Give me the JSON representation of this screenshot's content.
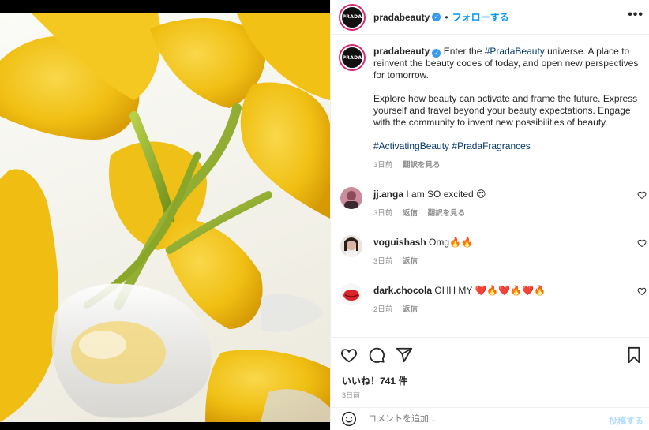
{
  "header": {
    "avatar_text": "PRADA",
    "username": "pradabeauty",
    "verified_mark": "✓",
    "dot": "•",
    "follow_label": "フォローする",
    "more_label": "•••"
  },
  "caption": {
    "avatar_text": "PRADA",
    "username": "pradabeauty",
    "text_1": "Enter the ",
    "tag_1": "#PradaBeauty",
    "text_2": " universe. A place to reinvent the beauty codes of today, and open new perspectives for tomorrow.",
    "paragraph_2": "Explore how beauty can activate and frame the future. Express yourself and travel beyond your beauty expectations. Engage with the community to invent new possibilities of beauty.",
    "tag_2": "#ActivatingBeauty",
    "tag_3": "#PradaFragrances",
    "time": "3日前",
    "translate": "翻訳を見る"
  },
  "comments": [
    {
      "username": "jj.anga",
      "text": "I am SO excited 😍",
      "time": "3日前",
      "reply": "返信",
      "translate": "翻訳を見る"
    },
    {
      "username": "voguishash",
      "text": "Omg🔥🔥",
      "time": "3日前",
      "reply": "返信"
    },
    {
      "username": "dark.chocola",
      "text": "OHH MY ❤️🔥❤️🔥❤️🔥",
      "time": "2日前",
      "reply": "返信"
    }
  ],
  "actions": {
    "likes": "いいね！741 件",
    "date": "3日前"
  },
  "comment_bar": {
    "placeholder": "コメントを追加...",
    "post_label": "投稿する"
  },
  "colors": {
    "accent": "#0095f6",
    "hashtag": "#00376b",
    "muted": "#8e8e8e",
    "petal": "#f2c21a"
  },
  "icons": [
    "verified-icon",
    "more-options-icon",
    "heart-icon",
    "comment-icon",
    "share-icon",
    "bookmark-icon",
    "emoji-icon"
  ]
}
